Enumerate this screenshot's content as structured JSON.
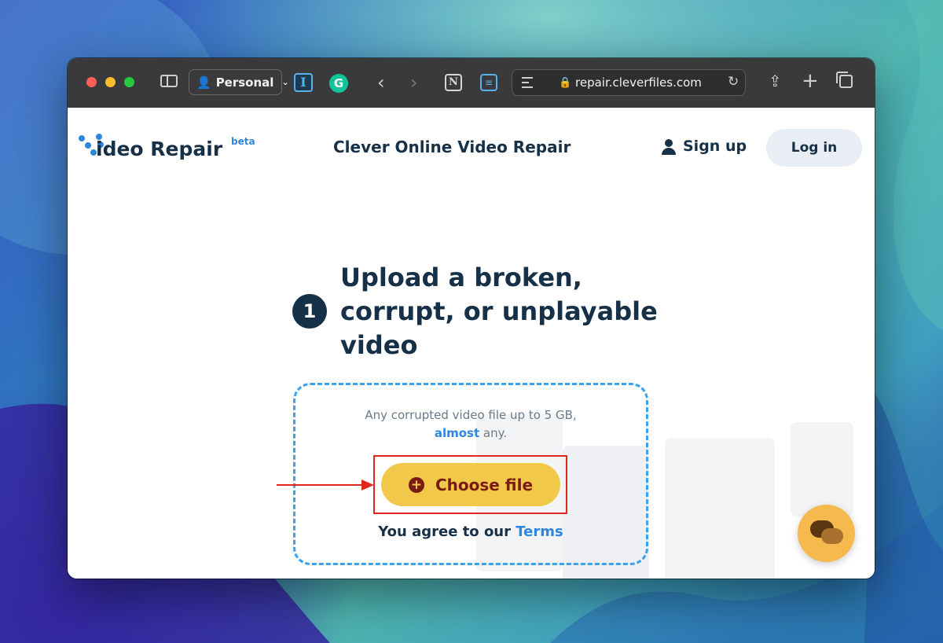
{
  "browser": {
    "profile_label": "Personal",
    "url": "repair.cleverfiles.com"
  },
  "site": {
    "logo_text": "ideo Repair",
    "logo_badge": "beta",
    "title": "Clever Online Video Repair",
    "signup_label": "Sign up",
    "login_label": "Log in"
  },
  "upload": {
    "step_number": "1",
    "headline": "Upload a broken, corrupt, or unplayable video",
    "desc_line1": "Any corrupted video file up to 5 GB,",
    "desc_almost": "almost",
    "desc_any": " any.",
    "choose_label": "Choose file",
    "terms_prefix": "You agree to our ",
    "terms_link": "Terms"
  },
  "colors": {
    "brand_dark": "#163047",
    "brand_blue": "#2f86e0",
    "button_yellow": "#f2c84b",
    "highlight_red": "#e0271f"
  }
}
